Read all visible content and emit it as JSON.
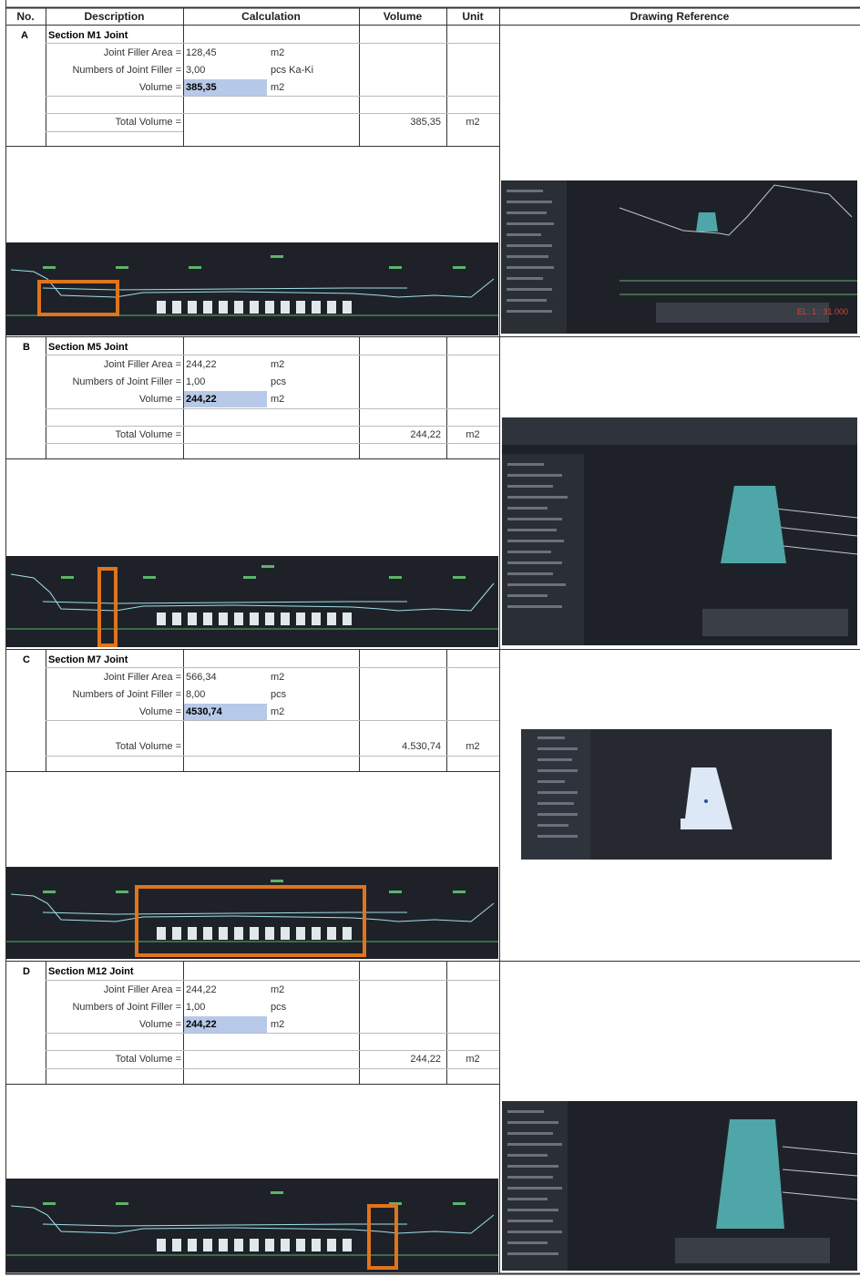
{
  "headers": {
    "no": "No.",
    "description": "Description",
    "calculation": "Calculation",
    "volume": "Volume",
    "unit": "Unit",
    "drawing_reference": "Drawing Reference"
  },
  "sections": [
    {
      "no": "A",
      "title": "Section M1 Joint",
      "area_label": "Joint Filler Area =",
      "area_value": "128,45",
      "area_unit": "m2",
      "count_label": "Numbers of Joint Filler =",
      "count_value": "3,00",
      "count_unit": "pcs Ka-Ki",
      "volume_label": "Volume =",
      "volume_value": "385,35",
      "volume_unit": "m2",
      "total_label": "Total Volume =",
      "total_value": "385,35",
      "total_unit": "m2"
    },
    {
      "no": "B",
      "title": "Section M5 Joint",
      "area_label": "Joint Filler Area =",
      "area_value": "244,22",
      "area_unit": "m2",
      "count_label": "Numbers of Joint Filler =",
      "count_value": "1,00",
      "count_unit": "pcs",
      "volume_label": "Volume =",
      "volume_value": "244,22",
      "volume_unit": "m2",
      "total_label": "Total Volume =",
      "total_value": "244,22",
      "total_unit": "m2"
    },
    {
      "no": "C",
      "title": "Section M7 Joint",
      "area_label": "Joint Filler Area =",
      "area_value": "566,34",
      "area_unit": "m2",
      "count_label": "Numbers of Joint Filler =",
      "count_value": "8,00",
      "count_unit": "pcs",
      "volume_label": "Volume =",
      "volume_value": "4530,74",
      "volume_unit": "m2",
      "total_label": "Total Volume =",
      "total_value": "4.530,74",
      "total_unit": "m2"
    },
    {
      "no": "D",
      "title": "Section M12 Joint",
      "area_label": "Joint Filler Area =",
      "area_value": "244,22",
      "area_unit": "m2",
      "count_label": "Numbers of Joint Filler =",
      "count_value": "1,00",
      "count_unit": "pcs",
      "volume_label": "Volume =",
      "volume_value": "244,22",
      "volume_unit": "m2",
      "total_label": "Total Volume =",
      "total_value": "244,22",
      "total_unit": "m2"
    }
  ],
  "drawing_a_readout": "EL. 1 : 31.000",
  "colors": {
    "highlight": "#b7c9e8",
    "marker": "#e0741e",
    "cad_bg": "#1e2228",
    "cad_line": "#9fe0ea",
    "fill": "#4fa6a8"
  }
}
